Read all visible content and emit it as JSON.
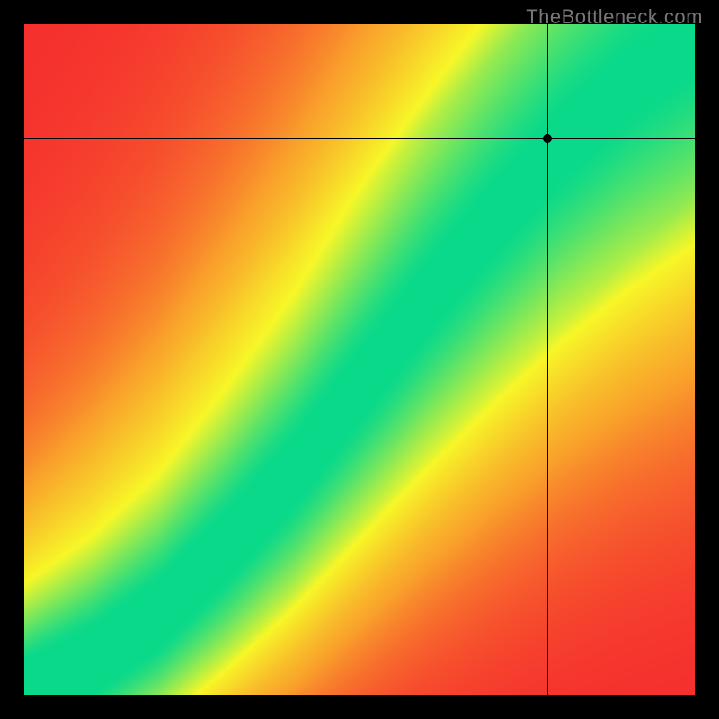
{
  "watermark": "TheBottleneck.com",
  "chart_data": {
    "type": "heatmap",
    "title": "",
    "xlabel": "",
    "ylabel": "",
    "xlim": [
      0,
      100
    ],
    "ylim": [
      0,
      100
    ],
    "color_scale_comment": "0 = red (worst), 100 = green (best), interpolated via red→orange→yellow→green",
    "color_stops": [
      {
        "t": 0.0,
        "hex": "#F52B2E"
      },
      {
        "t": 0.33,
        "hex": "#F9A12B"
      },
      {
        "t": 0.66,
        "hex": "#F7F728"
      },
      {
        "t": 1.0,
        "hex": "#0BD98A"
      }
    ],
    "ridge_comment": "Green optimum ridge y(x) as fraction of axis; ridge follows a mild S-curve from bottom-left to top-right, band width ~0.06",
    "ridge": [
      {
        "x": 0.0,
        "y": 0.0
      },
      {
        "x": 0.1,
        "y": 0.05
      },
      {
        "x": 0.2,
        "y": 0.12
      },
      {
        "x": 0.3,
        "y": 0.22
      },
      {
        "x": 0.4,
        "y": 0.33
      },
      {
        "x": 0.5,
        "y": 0.46
      },
      {
        "x": 0.6,
        "y": 0.59
      },
      {
        "x": 0.7,
        "y": 0.71
      },
      {
        "x": 0.8,
        "y": 0.82
      },
      {
        "x": 0.9,
        "y": 0.91
      },
      {
        "x": 1.0,
        "y": 0.98
      }
    ],
    "ridge_band_halfwidth": 0.05,
    "crosshair": {
      "x": 0.78,
      "y": 0.83
    }
  }
}
